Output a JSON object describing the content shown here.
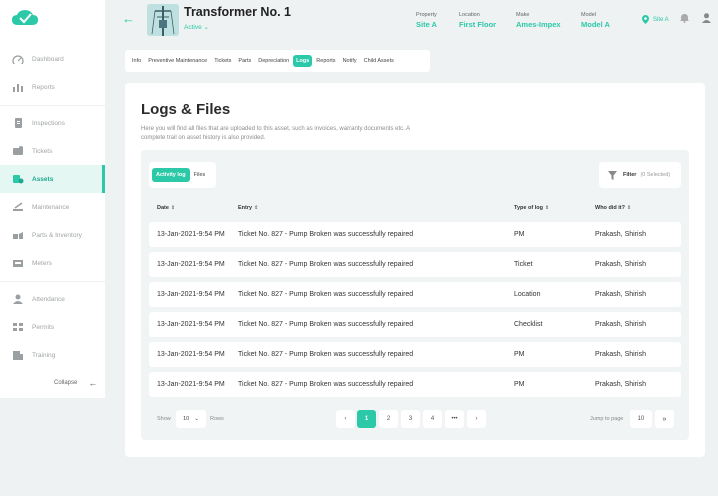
{
  "colors": {
    "accent": "#2cc9a8",
    "accent_light": "#e5f7f3",
    "text": "#333333",
    "muted": "#a0a4a6"
  },
  "sidebar": {
    "items": [
      {
        "label": "Dashboard",
        "icon": "dashboard-icon"
      },
      {
        "label": "Reports",
        "icon": "reports-icon"
      },
      {
        "label": "Inspections",
        "icon": "inspections-icon"
      },
      {
        "label": "Tickets",
        "icon": "tickets-icon"
      },
      {
        "label": "Assets",
        "icon": "assets-icon",
        "active": true
      },
      {
        "label": "Maintenance",
        "icon": "maintenance-icon"
      },
      {
        "label": "Parts & Inventory",
        "icon": "parts-icon"
      },
      {
        "label": "Meters",
        "icon": "meters-icon"
      },
      {
        "label": "Attendance",
        "icon": "attendance-icon"
      },
      {
        "label": "Permits",
        "icon": "permits-icon"
      },
      {
        "label": "Training",
        "icon": "training-icon"
      }
    ],
    "collapse_label": "Collapse"
  },
  "header": {
    "title": "Transformer No. 1",
    "status": "Active",
    "meta": [
      {
        "label": "Property",
        "value": "Site A"
      },
      {
        "label": "Location",
        "value": "First Floor"
      },
      {
        "label": "Make",
        "value": "Ames-Impex"
      },
      {
        "label": "Model",
        "value": "Model A"
      }
    ],
    "site": "Site A"
  },
  "tabs": [
    {
      "label": "Info"
    },
    {
      "label": "Preventive Maintenance"
    },
    {
      "label": "Tickets"
    },
    {
      "label": "Parts"
    },
    {
      "label": "Depreciation"
    },
    {
      "label": "Logs",
      "active": true
    },
    {
      "label": "Reports"
    },
    {
      "label": "Notify"
    },
    {
      "label": "Child Assets"
    }
  ],
  "page": {
    "title": "Logs & Files",
    "description": "Here you will find all files that are uploaded to this asset, such as invoices, warranty documents etc. A complete trail on asset history is also provided.",
    "toggle": {
      "activity_log": "Activity log",
      "files": "Files"
    },
    "filter": {
      "label": "Filter",
      "selected": "(0 Selected)"
    }
  },
  "table": {
    "headers": [
      "Date",
      "Entry",
      "Type of log",
      "Who did it?"
    ],
    "rows": [
      {
        "date": "13-Jan-2021-9:54 PM",
        "entry": "Ticket No. 827 - Pump Broken was successfully repaired",
        "type": "PM",
        "who": "Prakash, Shirish"
      },
      {
        "date": "13-Jan-2021-9:54 PM",
        "entry": "Ticket No. 827 - Pump Broken was successfully repaired",
        "type": "Ticket",
        "who": "Prakash, Shirish"
      },
      {
        "date": "13-Jan-2021-9:54 PM",
        "entry": "Ticket No. 827 - Pump Broken was successfully repaired",
        "type": "Location",
        "who": "Prakash, Shirish"
      },
      {
        "date": "13-Jan-2021-9:54 PM",
        "entry": "Ticket No. 827 - Pump Broken was successfully repaired",
        "type": "Checklist",
        "who": "Prakash, Shirish"
      },
      {
        "date": "13-Jan-2021-9:54 PM",
        "entry": "Ticket No. 827 - Pump Broken was successfully repaired",
        "type": "PM",
        "who": "Prakash, Shirish"
      },
      {
        "date": "13-Jan-2021-9:54 PM",
        "entry": "Ticket No. 827 - Pump Broken was successfully repaired",
        "type": "PM",
        "who": "Prakash, Shirish"
      }
    ]
  },
  "pagination": {
    "show_label": "Show",
    "rows_value": "10",
    "rows_label": "Rows",
    "pages": [
      "1",
      "2",
      "3",
      "4",
      "•••"
    ],
    "current": "1",
    "jump_label": "Jump to page",
    "jump_value": "10"
  }
}
